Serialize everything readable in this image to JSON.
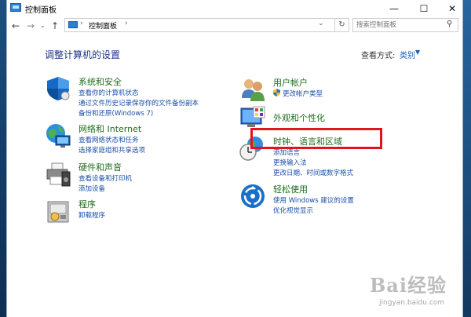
{
  "window": {
    "title": "控制面板",
    "controls": {
      "minimize": "—",
      "maximize": "☐",
      "close": "✕"
    }
  },
  "nav": {
    "back": "←",
    "forward": "→",
    "recent": "⌄",
    "up": "↑",
    "address_sep": "›",
    "address_text": "控制面板",
    "address_dropdown": "⌄",
    "refresh": "↻",
    "search_placeholder": "搜索控制面板",
    "search_glyph": "⚲"
  },
  "content": {
    "title": "调整计算机的设置",
    "view_by_label": "查看方式:",
    "view_by_value": "类别",
    "view_by_caret": "▼"
  },
  "categories_left": [
    {
      "title": "系统和安全",
      "icon": "shield-icon",
      "links": [
        "查看你的计算机状态",
        "通过文件历史记录保存你的文件备份副本",
        "备份和还原(Windows 7)"
      ]
    },
    {
      "title": "网络和 Internet",
      "icon": "network-globe-icon",
      "links": [
        "查看网络状态和任务",
        "选择家庭组和共享选项"
      ]
    },
    {
      "title": "硬件和声音",
      "icon": "printer-icon",
      "links": [
        "查看设备和打印机",
        "添加设备"
      ]
    },
    {
      "title": "程序",
      "icon": "programs-icon",
      "links": [
        "卸载程序"
      ]
    }
  ],
  "categories_right": [
    {
      "title": "用户帐户",
      "icon": "users-icon",
      "links": [
        "更改帐户类型"
      ]
    },
    {
      "title": "外观和个性化",
      "icon": "appearance-icon",
      "links": []
    },
    {
      "title": "时钟、语言和区域",
      "icon": "clock-globe-icon",
      "links": [
        "添加语言",
        "更换输入法",
        "更改日期、时间或数字格式"
      ]
    },
    {
      "title": "轻松使用",
      "icon": "ease-of-access-icon",
      "links": [
        "使用 Windows 建议的设置",
        "优化视觉显示"
      ]
    }
  ],
  "watermark": {
    "brand": "Bai经验",
    "url": "jingyan.baidu.com"
  },
  "colors": {
    "category_title": "#1d6e1d",
    "link": "#1a4fa8",
    "page_title": "#1e3287",
    "highlight": "#e0141e"
  }
}
